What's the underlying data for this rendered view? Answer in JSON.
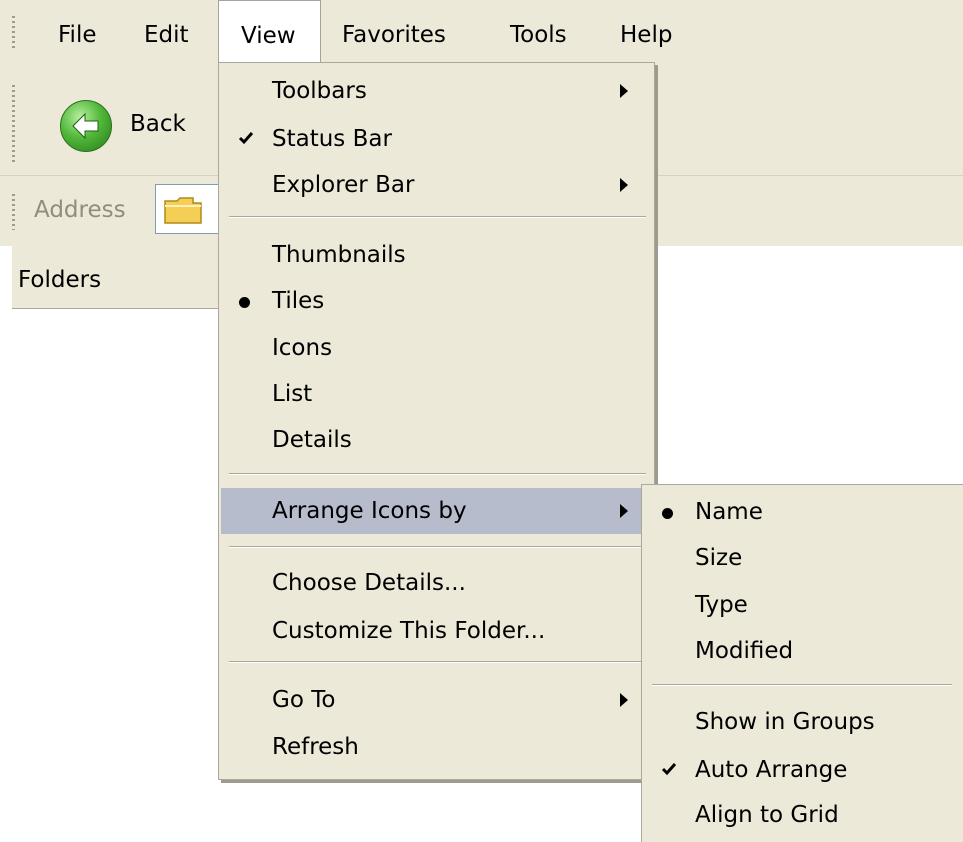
{
  "menubar": {
    "items": [
      {
        "label": "File"
      },
      {
        "label": "Edit"
      },
      {
        "label": "View"
      },
      {
        "label": "Favorites"
      },
      {
        "label": "Tools"
      },
      {
        "label": "Help"
      }
    ]
  },
  "toolbar": {
    "back_label": "Back"
  },
  "addressbar": {
    "label": "Address"
  },
  "folders_pane": {
    "title": "Folders"
  },
  "view_menu": {
    "items": [
      {
        "label": "Toolbars",
        "submenu": true
      },
      {
        "label": "Status Bar",
        "checked": true
      },
      {
        "label": "Explorer Bar",
        "submenu": true
      },
      {
        "label": "Thumbnails"
      },
      {
        "label": "Tiles",
        "selected": true
      },
      {
        "label": "Icons"
      },
      {
        "label": "List"
      },
      {
        "label": "Details"
      },
      {
        "label": "Arrange Icons by",
        "submenu": true,
        "highlighted": true
      },
      {
        "label": "Choose Details..."
      },
      {
        "label": "Customize This Folder..."
      },
      {
        "label": "Go To",
        "submenu": true
      },
      {
        "label": "Refresh"
      }
    ]
  },
  "arrange_submenu": {
    "items": [
      {
        "label": "Name",
        "selected": true
      },
      {
        "label": "Size"
      },
      {
        "label": "Type"
      },
      {
        "label": "Modified"
      },
      {
        "label": "Show in Groups"
      },
      {
        "label": "Auto Arrange",
        "checked": true
      },
      {
        "label": "Align to Grid"
      }
    ]
  },
  "colors": {
    "chrome": "#ece9d8",
    "menu_highlight": "#b6bccc",
    "separator": "#aca899"
  }
}
